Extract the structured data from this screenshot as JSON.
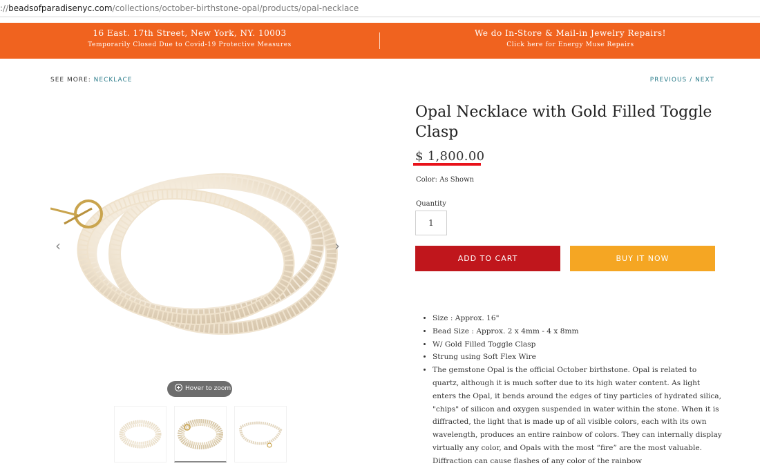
{
  "browser": {
    "url_scheme": "://",
    "url_domain": "beadsofparadisenyc.com",
    "url_path": "/collections/october-birthstone-opal/products/opal-necklace"
  },
  "announcement": {
    "left_main": "16 East. 17th Street, New York, NY. 10003",
    "left_sub": "Temporarily Closed Due to Covid-19 Protective Measures",
    "right_main": "We do In-Store & Mail-in Jewelry Repairs!",
    "right_sub": "Click here for Energy Muse Repairs"
  },
  "breadcrumb": {
    "prefix": "SEE MORE:",
    "link": "NECKLACE",
    "previous": "PREVIOUS",
    "separator": "/",
    "next": "NEXT"
  },
  "gallery": {
    "zoom_hint": "Hover to zoom",
    "thumbnail_count": 3,
    "active_thumbnail": 2
  },
  "product": {
    "title": "Opal Necklace with Gold Filled Toggle Clasp",
    "price": "$ 1,800.00",
    "color_label": "Color:",
    "color_value": "As Shown",
    "quantity_label": "Quantity",
    "quantity_value": "1",
    "add_to_cart": "ADD TO CART",
    "buy_it_now": "BUY IT NOW"
  },
  "description": [
    "Size : Approx. 16\"",
    "Bead Size : Approx. 2 x 4mm - 4 x 8mm",
    "W/ Gold Filled Toggle Clasp",
    "Strung using Soft Flex Wire",
    "The gemstone Opal is the official October birthstone. Opal is related to quartz, although it is much softer due to its high water content. As light enters the Opal, it bends around the edges of tiny particles of hydrated silica, \"chips\" of silicon and oxygen suspended in water within the stone. When it is diffracted, the light that is made up of all visible colors, each with its own wavelength, produces an entire rainbow of colors. They can internally display virtually any color, and Opals with the most “fire” are the most valuable. Diffraction can cause flashes of any color of the rainbow"
  ],
  "colors": {
    "announcement_bg": "#f0631f",
    "link": "#2a7c8a",
    "add_to_cart_bg": "#c0161c",
    "buy_now_bg": "#f5a623",
    "price_underline": "#e8121a"
  }
}
